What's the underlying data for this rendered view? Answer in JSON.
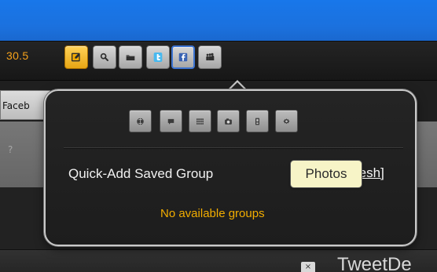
{
  "app": {
    "version": "30.5"
  },
  "toolbar": {
    "buttons": [
      {
        "name": "compose",
        "icon": "compose-icon"
      },
      {
        "name": "search",
        "icon": "search-icon"
      },
      {
        "name": "folder",
        "icon": "folder-icon"
      },
      {
        "name": "twitter",
        "icon": "twitter-icon"
      },
      {
        "name": "facebook",
        "icon": "facebook-icon"
      },
      {
        "name": "myspace",
        "icon": "myspace-icon"
      }
    ]
  },
  "background": {
    "facebook_tab_label": "Faceb",
    "marker": "?",
    "column_title": "TweetDe"
  },
  "popup": {
    "tabs": [
      {
        "name": "globe",
        "icon": "globe-icon"
      },
      {
        "name": "chat",
        "icon": "chat-icon"
      },
      {
        "name": "grid",
        "icon": "grid-icon"
      },
      {
        "name": "photos",
        "icon": "camera-icon"
      },
      {
        "name": "device",
        "icon": "device-icon"
      },
      {
        "name": "settings",
        "icon": "gear-icon"
      }
    ],
    "title": "Quick-Add Saved Group",
    "refresh_label": "resh]",
    "tooltip": "Photos",
    "empty_state": "No available groups"
  },
  "colors": {
    "top_bar": "#1877ea",
    "accent": "#f6a21a",
    "tooltip_bg": "#f7f4c7",
    "empty_text": "#f2ad00"
  }
}
